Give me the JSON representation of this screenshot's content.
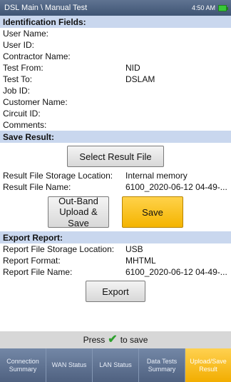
{
  "title_bar": {
    "title": "DSL Main \\ Manual Test",
    "time": "4:50 AM",
    "battery_icon": "battery-icon"
  },
  "identification": {
    "header": "Identification Fields:",
    "fields": [
      {
        "label": "User Name:",
        "value": ""
      },
      {
        "label": "User ID:",
        "value": ""
      },
      {
        "label": "Contractor Name:",
        "value": ""
      },
      {
        "label": "Test From:",
        "value": "NID"
      },
      {
        "label": "Test To:",
        "value": "DSLAM"
      },
      {
        "label": "Job ID:",
        "value": ""
      },
      {
        "label": "Customer Name:",
        "value": ""
      },
      {
        "label": "Circuit ID:",
        "value": ""
      },
      {
        "label": "Comments:",
        "value": ""
      }
    ]
  },
  "save_result": {
    "header": "Save Result:",
    "select_button": "Select Result File",
    "storage_label": "Result File Storage Location:",
    "storage_value": "Internal memory",
    "file_label": "Result File Name:",
    "file_value": "6100_2020-06-12 04-49-...",
    "outband_button_line1": "Out-Band",
    "outband_button_line2": "Upload & Save",
    "save_button": "Save"
  },
  "export_report": {
    "header": "Export Report:",
    "storage_label": "Report File Storage Location:",
    "storage_value": "USB",
    "format_label": "Report Format:",
    "format_value": "MHTML",
    "file_label": "Report File Name:",
    "file_value": "6100_2020-06-12 04-49-...",
    "export_button": "Export"
  },
  "press_bar": {
    "prefix": "Press",
    "suffix": "to save",
    "icon": "checkmark-icon"
  },
  "tabs": [
    {
      "line1": "Connection",
      "line2": "Summary"
    },
    {
      "line1": "WAN Status",
      "line2": ""
    },
    {
      "line1": "LAN Status",
      "line2": ""
    },
    {
      "line1": "Data Tests",
      "line2": "Summary"
    },
    {
      "line1": "Upload/Save",
      "line2": "Result"
    }
  ],
  "colors": {
    "section_bg": "#c9d7ee",
    "accent": "#f4b400",
    "tab_bg": "#4f6180"
  }
}
